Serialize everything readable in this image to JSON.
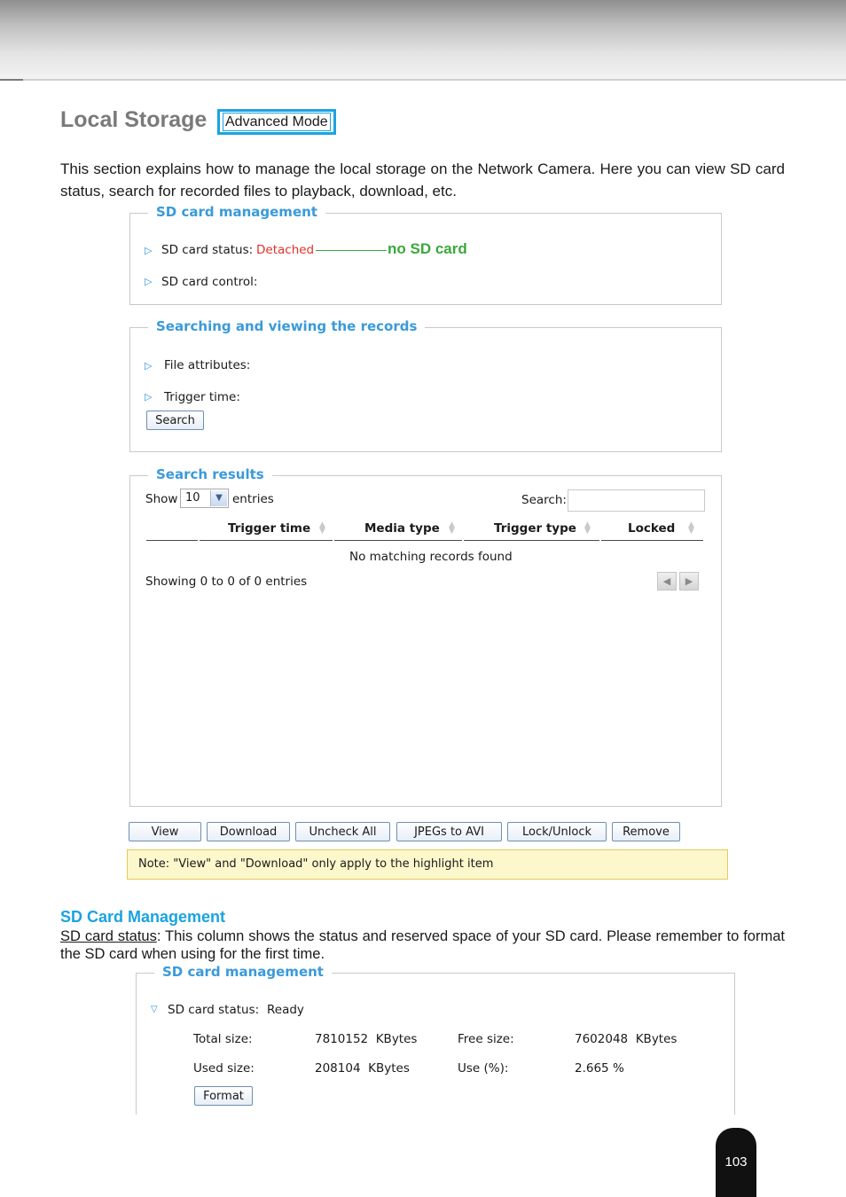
{
  "header": {
    "section_title": "Local Storage",
    "mode_badge": "Advanced Mode"
  },
  "intro_text": "This section explains how to manage the local storage on the Network Camera. Here you can view SD card status, search for recorded files to playback, download, etc.",
  "sd_card_panel": {
    "legend": "SD card management",
    "status_label": "SD card status:",
    "status_value": "Detached",
    "annotation": "no SD card",
    "control_label": "SD card control:"
  },
  "search_panel": {
    "legend": "Searching and viewing the records",
    "file_attributes_label": "File attributes:",
    "trigger_time_label": "Trigger time:",
    "search_button": "Search"
  },
  "results_panel": {
    "legend": "Search results",
    "show_label": "Show",
    "entries_value": "10",
    "entries_label": "entries",
    "search_label": "Search:",
    "columns": [
      "Trigger time",
      "Media type",
      "Trigger type",
      "Locked"
    ],
    "empty_message": "No matching records found",
    "info": "Showing 0 to 0 of 0 entries"
  },
  "action_buttons": [
    "View",
    "Download",
    "Uncheck All",
    "JPEGs to AVI",
    "Lock/Unlock",
    "Remove"
  ],
  "note": "Note: \"View\" and \"Download\" only apply to the highlight item",
  "sd_management_section": {
    "heading": "SD Card Management",
    "link_text": "SD card status",
    "description": ": This column shows the status and reserved space of your SD card. Please remember to format the SD card when using for the first time."
  },
  "sd_card_panel_2": {
    "legend": "SD card management",
    "status_label": "SD card status:",
    "status_value": "Ready",
    "total_size_label": "Total size:",
    "total_size_value": "7810152  KBytes",
    "free_size_label": "Free size:",
    "free_size_value": "7602048  KBytes",
    "used_size_label": "Used size:",
    "used_size_value": "208104  KBytes",
    "use_pct_label": "Use (%):",
    "use_pct_value": "2.665 %",
    "format_button": "Format"
  },
  "page_number": "103",
  "colors": {
    "accent_blue": "#1aa3e0",
    "legend_blue": "#3a9ad9",
    "status_red": "#e0302a",
    "annotation_green": "#3aa83a"
  }
}
